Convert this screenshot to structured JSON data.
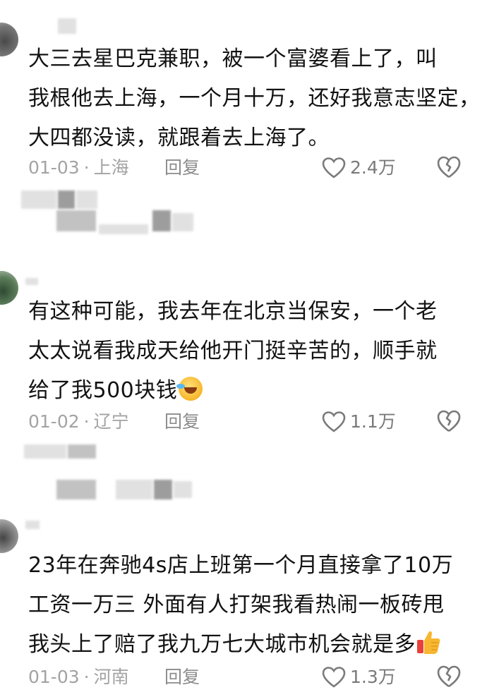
{
  "comments": [
    {
      "lines": [
        "大三去星巴克兼职，被一个富婆看上了，叫",
        "我根他去上海，一个月十万，还好我意志坚定，",
        "大四都没读，就跟着去上海了。"
      ],
      "date": "01-03",
      "location": "上海",
      "reply_label": "回复",
      "likes": "2.4万"
    },
    {
      "lines": [
        "有这种可能，我去年在北京当保安，一个老",
        "太太说看我成天给他开门挺辛苦的，顺手就",
        "给了我500块钱"
      ],
      "emoji": "rolling-laughing",
      "date": "01-02",
      "location": "辽宁",
      "reply_label": "回复",
      "likes": "1.1万"
    },
    {
      "lines": [
        "23年在奔驰4s店上班第一个月直接拿了10万",
        "工资一万三 外面有人打架我看热闹一板砖甩",
        "我头上了赔了我九万七大城市机会就是多"
      ],
      "emoji": "thumbs-up",
      "date": "01-03",
      "location": "河南",
      "reply_label": "回复",
      "likes": "1.3万"
    }
  ],
  "colors": {
    "text": "#121212",
    "meta": "#a3a3a3",
    "icon": "#7a7a7a"
  }
}
